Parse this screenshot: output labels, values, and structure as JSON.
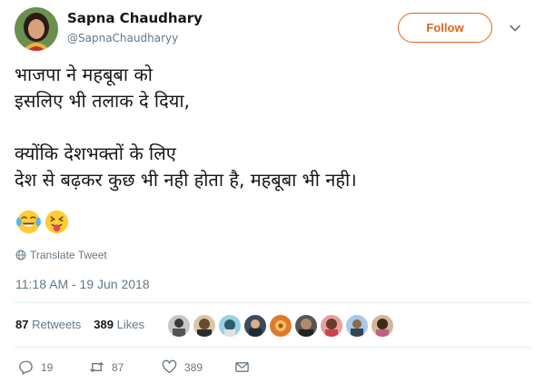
{
  "user": {
    "name": "Sapna Chaudhary",
    "handle": "@SapnaChaudharyy"
  },
  "follow_label": "Follow",
  "tweet": {
    "text": "भाजपा ने महबूबा को\nइसलिए भी तलाक दे दिया,\n\nक्योंकि देशभक्तों के लिए\nदेश से बढ़कर कुछ भी नही होता है, महबूबा भी नही।",
    "emojis": [
      "face-with-tears-of-joy-icon",
      "squinting-face-with-tongue-icon"
    ]
  },
  "translate_label": "Translate Tweet",
  "timestamp": "11:18 AM - 19 Jun 2018",
  "stats": {
    "retweets": "87",
    "retweets_label": "Retweets",
    "likes": "389",
    "likes_label": "Likes"
  },
  "liker_avatars": [
    "liker-avatar",
    "liker-avatar",
    "liker-avatar",
    "liker-avatar",
    "liker-avatar",
    "liker-avatar",
    "liker-avatar",
    "liker-avatar",
    "liker-avatar"
  ],
  "actions": {
    "replies": "19",
    "retweets": "87",
    "likes": "389"
  },
  "colors": {
    "accent": "#e0651e",
    "muted": "#657786",
    "text": "#14171a",
    "divider": "#e6ecf0"
  }
}
